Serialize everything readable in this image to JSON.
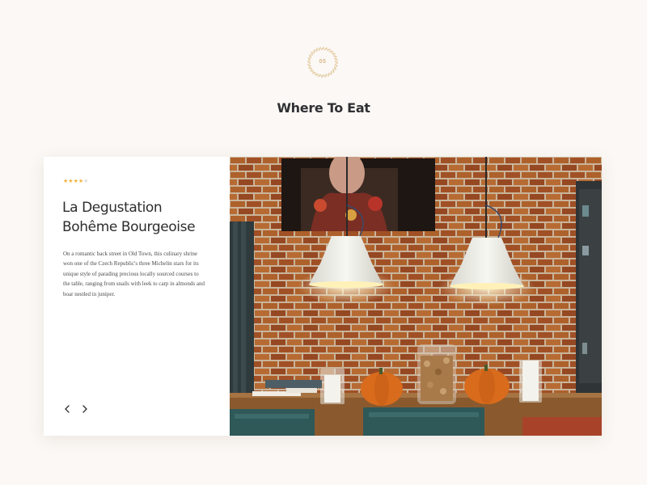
{
  "section": {
    "number": "05",
    "title": "Where To Eat",
    "badge_icon": "laurel-wreath-icon",
    "accent_color": "#d9b98a"
  },
  "restaurant": {
    "rating": 4,
    "rating_max": 5,
    "star_color": "#f2b33d",
    "name_lines": [
      "La Degustation",
      "Bohême Bourgeoise"
    ],
    "description": "On a romantic back street in Old Town, this culinary shrine won one of the Czech Republic's three Michelin stars for its unique style of parading precious locally sourced courses to the table, ranging from snails with leek to carp in almonds and boar nestled in juniper.",
    "photo_icon": "restaurant-interior-photo"
  },
  "navigation": {
    "prev_icon": "chevron-left-icon",
    "next_icon": "chevron-right-icon"
  }
}
